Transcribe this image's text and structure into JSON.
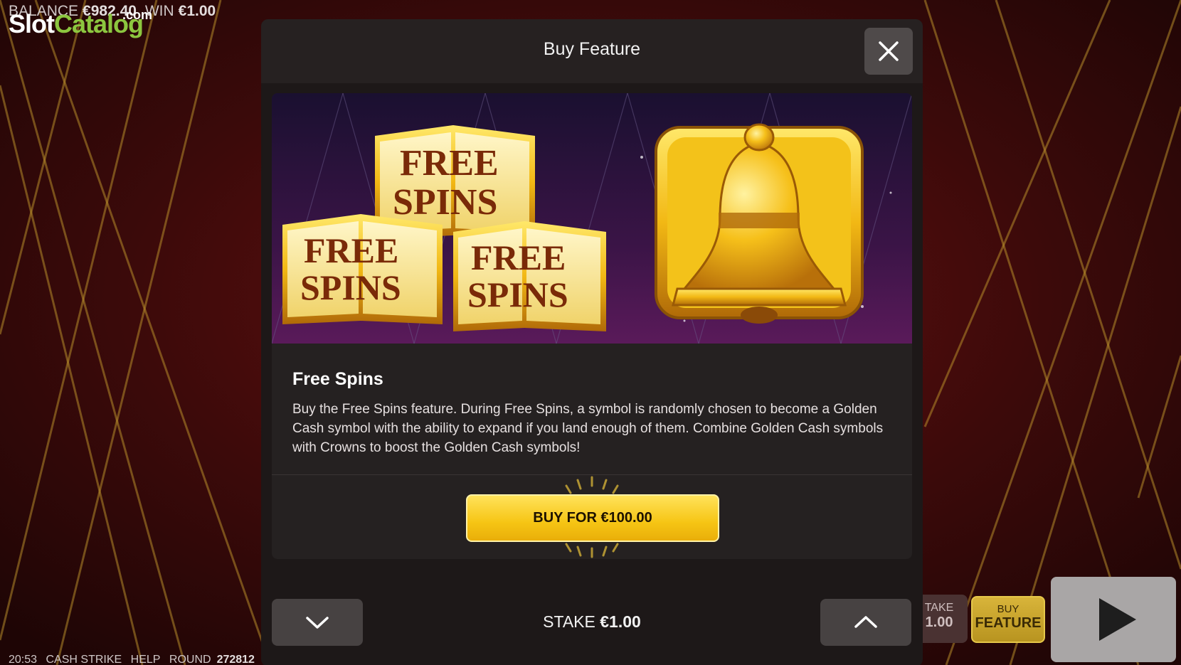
{
  "hud": {
    "balance_label": "BALANCE",
    "balance_value": "€982.40",
    "win_label": "WIN",
    "win_value": "€1.00",
    "time": "20:53",
    "game_name": "CASH STRIKE",
    "help_label": "HELP",
    "round_label": "ROUND",
    "round_value": "272812"
  },
  "watermark": {
    "part1": "Slot",
    "part2": "Catalog",
    "part3": ".com"
  },
  "modal": {
    "title": "Buy Feature",
    "feature_title": "Free Spins",
    "feature_description": "Buy the Free Spins feature. During Free Spins, a symbol is randomly chosen to become a Golden Cash symbol with the ability to expand if you land enough of them. Combine Golden Cash symbols with Crowns to boost the Golden Cash symbols!",
    "buy_button_label": "BUY FOR €100.00",
    "stake_label": "STAKE",
    "stake_value": "€1.00",
    "book_text_line1": "FREE",
    "book_text_line2": "SPINS"
  },
  "controls": {
    "stake_label_partial": "TAKE",
    "stake_value_partial": "1.00",
    "buy_feature_line1": "BUY",
    "buy_feature_line2": "FEATURE"
  },
  "icons": {
    "close": "close-icon",
    "stake_down": "chevron-down-icon",
    "stake_up": "chevron-up-icon",
    "spin": "play-icon",
    "free_spins_symbol": "free-spins-book-icon",
    "bell_symbol": "bell-icon"
  },
  "colors": {
    "accent_gold": "#f6c514",
    "modal_bg": "#1d1818",
    "background_red": "#2a0707"
  }
}
